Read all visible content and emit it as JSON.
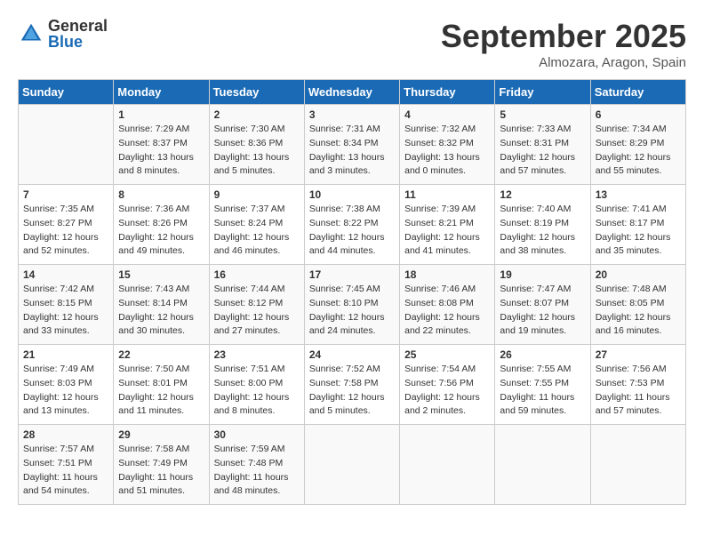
{
  "logo": {
    "general": "General",
    "blue": "Blue"
  },
  "title": "September 2025",
  "location": "Almozara, Aragon, Spain",
  "days_of_week": [
    "Sunday",
    "Monday",
    "Tuesday",
    "Wednesday",
    "Thursday",
    "Friday",
    "Saturday"
  ],
  "weeks": [
    [
      {
        "num": "",
        "sunrise": "",
        "sunset": "",
        "daylight": ""
      },
      {
        "num": "1",
        "sunrise": "Sunrise: 7:29 AM",
        "sunset": "Sunset: 8:37 PM",
        "daylight": "Daylight: 13 hours and 8 minutes."
      },
      {
        "num": "2",
        "sunrise": "Sunrise: 7:30 AM",
        "sunset": "Sunset: 8:36 PM",
        "daylight": "Daylight: 13 hours and 5 minutes."
      },
      {
        "num": "3",
        "sunrise": "Sunrise: 7:31 AM",
        "sunset": "Sunset: 8:34 PM",
        "daylight": "Daylight: 13 hours and 3 minutes."
      },
      {
        "num": "4",
        "sunrise": "Sunrise: 7:32 AM",
        "sunset": "Sunset: 8:32 PM",
        "daylight": "Daylight: 13 hours and 0 minutes."
      },
      {
        "num": "5",
        "sunrise": "Sunrise: 7:33 AM",
        "sunset": "Sunset: 8:31 PM",
        "daylight": "Daylight: 12 hours and 57 minutes."
      },
      {
        "num": "6",
        "sunrise": "Sunrise: 7:34 AM",
        "sunset": "Sunset: 8:29 PM",
        "daylight": "Daylight: 12 hours and 55 minutes."
      }
    ],
    [
      {
        "num": "7",
        "sunrise": "Sunrise: 7:35 AM",
        "sunset": "Sunset: 8:27 PM",
        "daylight": "Daylight: 12 hours and 52 minutes."
      },
      {
        "num": "8",
        "sunrise": "Sunrise: 7:36 AM",
        "sunset": "Sunset: 8:26 PM",
        "daylight": "Daylight: 12 hours and 49 minutes."
      },
      {
        "num": "9",
        "sunrise": "Sunrise: 7:37 AM",
        "sunset": "Sunset: 8:24 PM",
        "daylight": "Daylight: 12 hours and 46 minutes."
      },
      {
        "num": "10",
        "sunrise": "Sunrise: 7:38 AM",
        "sunset": "Sunset: 8:22 PM",
        "daylight": "Daylight: 12 hours and 44 minutes."
      },
      {
        "num": "11",
        "sunrise": "Sunrise: 7:39 AM",
        "sunset": "Sunset: 8:21 PM",
        "daylight": "Daylight: 12 hours and 41 minutes."
      },
      {
        "num": "12",
        "sunrise": "Sunrise: 7:40 AM",
        "sunset": "Sunset: 8:19 PM",
        "daylight": "Daylight: 12 hours and 38 minutes."
      },
      {
        "num": "13",
        "sunrise": "Sunrise: 7:41 AM",
        "sunset": "Sunset: 8:17 PM",
        "daylight": "Daylight: 12 hours and 35 minutes."
      }
    ],
    [
      {
        "num": "14",
        "sunrise": "Sunrise: 7:42 AM",
        "sunset": "Sunset: 8:15 PM",
        "daylight": "Daylight: 12 hours and 33 minutes."
      },
      {
        "num": "15",
        "sunrise": "Sunrise: 7:43 AM",
        "sunset": "Sunset: 8:14 PM",
        "daylight": "Daylight: 12 hours and 30 minutes."
      },
      {
        "num": "16",
        "sunrise": "Sunrise: 7:44 AM",
        "sunset": "Sunset: 8:12 PM",
        "daylight": "Daylight: 12 hours and 27 minutes."
      },
      {
        "num": "17",
        "sunrise": "Sunrise: 7:45 AM",
        "sunset": "Sunset: 8:10 PM",
        "daylight": "Daylight: 12 hours and 24 minutes."
      },
      {
        "num": "18",
        "sunrise": "Sunrise: 7:46 AM",
        "sunset": "Sunset: 8:08 PM",
        "daylight": "Daylight: 12 hours and 22 minutes."
      },
      {
        "num": "19",
        "sunrise": "Sunrise: 7:47 AM",
        "sunset": "Sunset: 8:07 PM",
        "daylight": "Daylight: 12 hours and 19 minutes."
      },
      {
        "num": "20",
        "sunrise": "Sunrise: 7:48 AM",
        "sunset": "Sunset: 8:05 PM",
        "daylight": "Daylight: 12 hours and 16 minutes."
      }
    ],
    [
      {
        "num": "21",
        "sunrise": "Sunrise: 7:49 AM",
        "sunset": "Sunset: 8:03 PM",
        "daylight": "Daylight: 12 hours and 13 minutes."
      },
      {
        "num": "22",
        "sunrise": "Sunrise: 7:50 AM",
        "sunset": "Sunset: 8:01 PM",
        "daylight": "Daylight: 12 hours and 11 minutes."
      },
      {
        "num": "23",
        "sunrise": "Sunrise: 7:51 AM",
        "sunset": "Sunset: 8:00 PM",
        "daylight": "Daylight: 12 hours and 8 minutes."
      },
      {
        "num": "24",
        "sunrise": "Sunrise: 7:52 AM",
        "sunset": "Sunset: 7:58 PM",
        "daylight": "Daylight: 12 hours and 5 minutes."
      },
      {
        "num": "25",
        "sunrise": "Sunrise: 7:54 AM",
        "sunset": "Sunset: 7:56 PM",
        "daylight": "Daylight: 12 hours and 2 minutes."
      },
      {
        "num": "26",
        "sunrise": "Sunrise: 7:55 AM",
        "sunset": "Sunset: 7:55 PM",
        "daylight": "Daylight: 11 hours and 59 minutes."
      },
      {
        "num": "27",
        "sunrise": "Sunrise: 7:56 AM",
        "sunset": "Sunset: 7:53 PM",
        "daylight": "Daylight: 11 hours and 57 minutes."
      }
    ],
    [
      {
        "num": "28",
        "sunrise": "Sunrise: 7:57 AM",
        "sunset": "Sunset: 7:51 PM",
        "daylight": "Daylight: 11 hours and 54 minutes."
      },
      {
        "num": "29",
        "sunrise": "Sunrise: 7:58 AM",
        "sunset": "Sunset: 7:49 PM",
        "daylight": "Daylight: 11 hours and 51 minutes."
      },
      {
        "num": "30",
        "sunrise": "Sunrise: 7:59 AM",
        "sunset": "Sunset: 7:48 PM",
        "daylight": "Daylight: 11 hours and 48 minutes."
      },
      {
        "num": "",
        "sunrise": "",
        "sunset": "",
        "daylight": ""
      },
      {
        "num": "",
        "sunrise": "",
        "sunset": "",
        "daylight": ""
      },
      {
        "num": "",
        "sunrise": "",
        "sunset": "",
        "daylight": ""
      },
      {
        "num": "",
        "sunrise": "",
        "sunset": "",
        "daylight": ""
      }
    ]
  ]
}
